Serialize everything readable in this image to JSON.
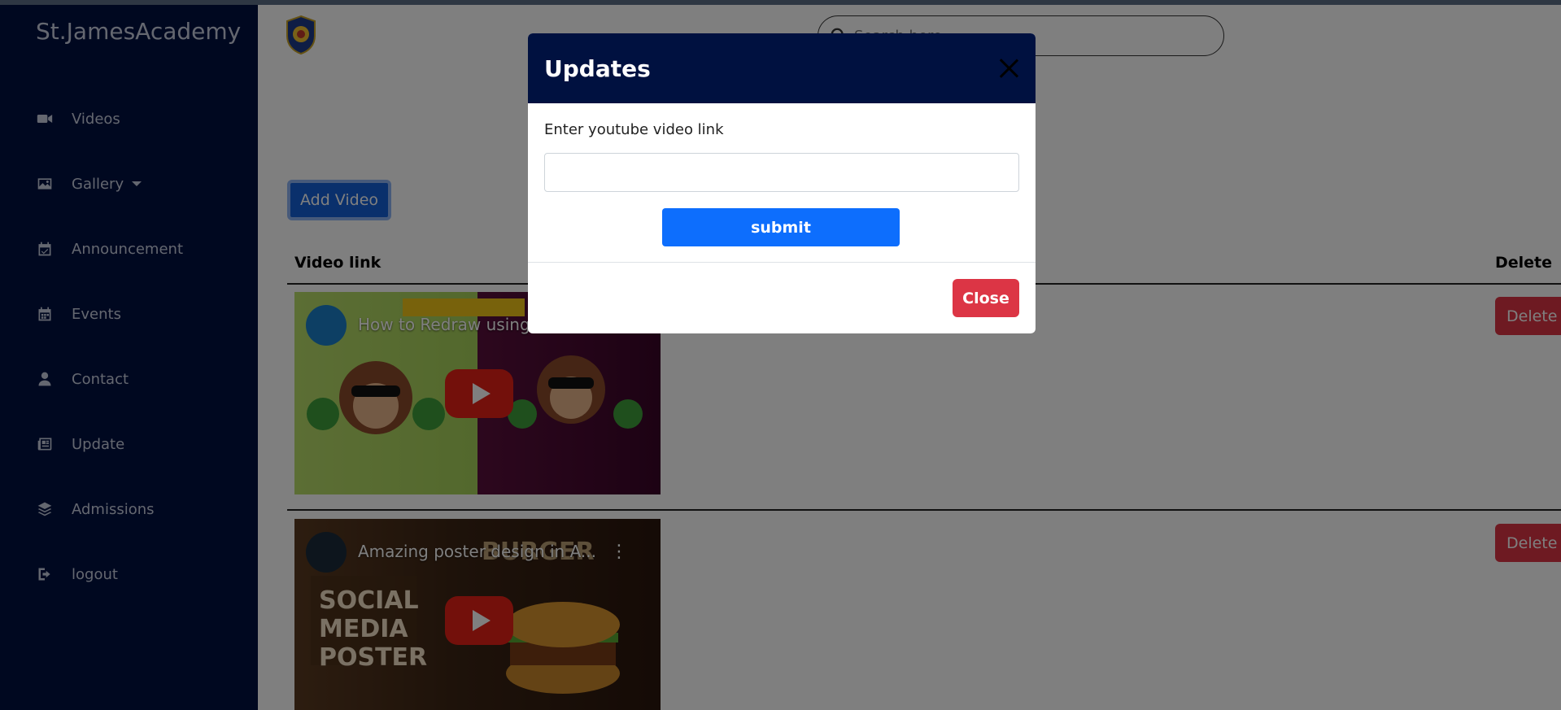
{
  "app": {
    "brand": "St.JamesAcademy"
  },
  "sidebar": {
    "items": [
      {
        "label": "Videos",
        "icon": "video-camera-icon"
      },
      {
        "label": "Gallery",
        "icon": "image-icon",
        "has_dropdown": true
      },
      {
        "label": "Announcement",
        "icon": "calendar-check-icon"
      },
      {
        "label": "Events",
        "icon": "calendar-icon"
      },
      {
        "label": "Contact",
        "icon": "user-icon"
      },
      {
        "label": "Update",
        "icon": "newspaper-icon"
      },
      {
        "label": "Admissions",
        "icon": "layers-icon"
      },
      {
        "label": "logout",
        "icon": "sign-out-icon"
      }
    ]
  },
  "header": {
    "search_placeholder": "Search here"
  },
  "main": {
    "add_button": "Add Video",
    "table": {
      "columns": [
        "Video link",
        "Delete"
      ],
      "rows": [
        {
          "title": "How to Redraw using",
          "delete_label": "Delete"
        },
        {
          "title": "Amazing poster design in A...",
          "delete_label": "Delete"
        }
      ]
    }
  },
  "modal": {
    "title": "Updates",
    "label": "Enter youtube video link",
    "input_value": "",
    "submit_label": "submit",
    "close_label": "Close"
  },
  "colors": {
    "sidebar_bg": "#001140",
    "primary": "#0d6efd",
    "danger": "#dc3545"
  }
}
